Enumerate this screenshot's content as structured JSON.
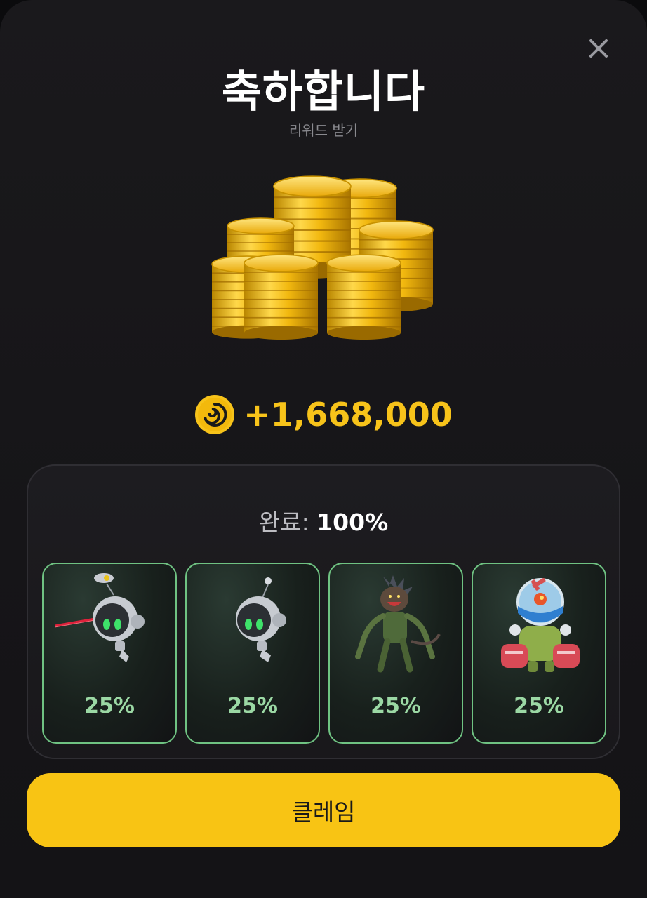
{
  "header": {
    "title": "축하합니다",
    "subtitle": "리워드 받기",
    "close_icon": "close-icon"
  },
  "reward": {
    "icon": "coin-icon",
    "amount": "+1,668,000"
  },
  "progress": {
    "label": "완료:",
    "value": "100%"
  },
  "cards": [
    {
      "name": "robot-drone-laser",
      "percent": "25%"
    },
    {
      "name": "robot-drone",
      "percent": "25%"
    },
    {
      "name": "alien-creature",
      "percent": "25%"
    },
    {
      "name": "aquarium-robot",
      "percent": "25%"
    }
  ],
  "claim_button": {
    "label": "클레임"
  },
  "colors": {
    "accent": "#f8c414",
    "gold_text": "#f7c31a",
    "card_border": "#6fc282",
    "card_percent": "#9bd8a4"
  }
}
